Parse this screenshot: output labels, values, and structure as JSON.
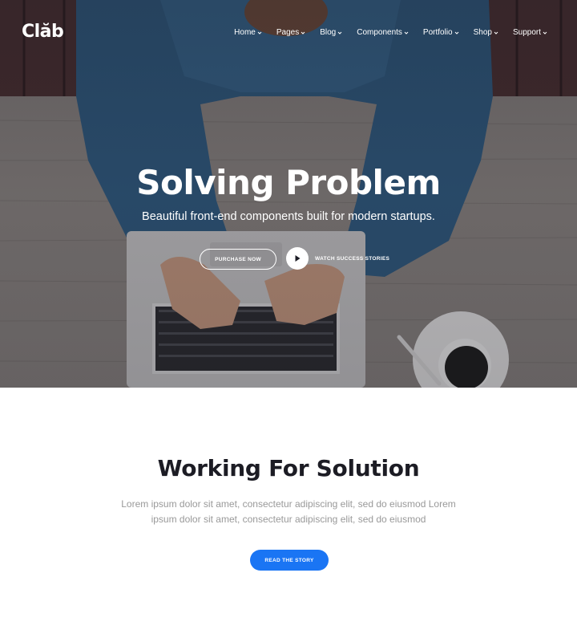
{
  "brand": {
    "logo": "Clăb"
  },
  "nav": {
    "items": [
      {
        "label": "Home"
      },
      {
        "label": "Pages"
      },
      {
        "label": "Blog"
      },
      {
        "label": "Components"
      },
      {
        "label": "Portfolio"
      },
      {
        "label": "Shop"
      },
      {
        "label": "Support"
      }
    ]
  },
  "hero": {
    "title": "Solving Problem",
    "subtitle": "Beautiful front-end components built for modern startups.",
    "purchase_label": "PURCHASE NOW",
    "watch_label": "WATCH SUCCESS STORIES"
  },
  "section": {
    "title": "Working For Solution",
    "text": "Lorem ipsum dolor sit amet, consectetur adipiscing elit, sed do eiusmod Lorem ipsum dolor sit amet, consectetur adipiscing elit, sed do eiusmod",
    "button_label": "READ THE STORY"
  },
  "colors": {
    "accent": "#1a75f4",
    "heading": "#1c1c24",
    "body_text": "#999999"
  }
}
